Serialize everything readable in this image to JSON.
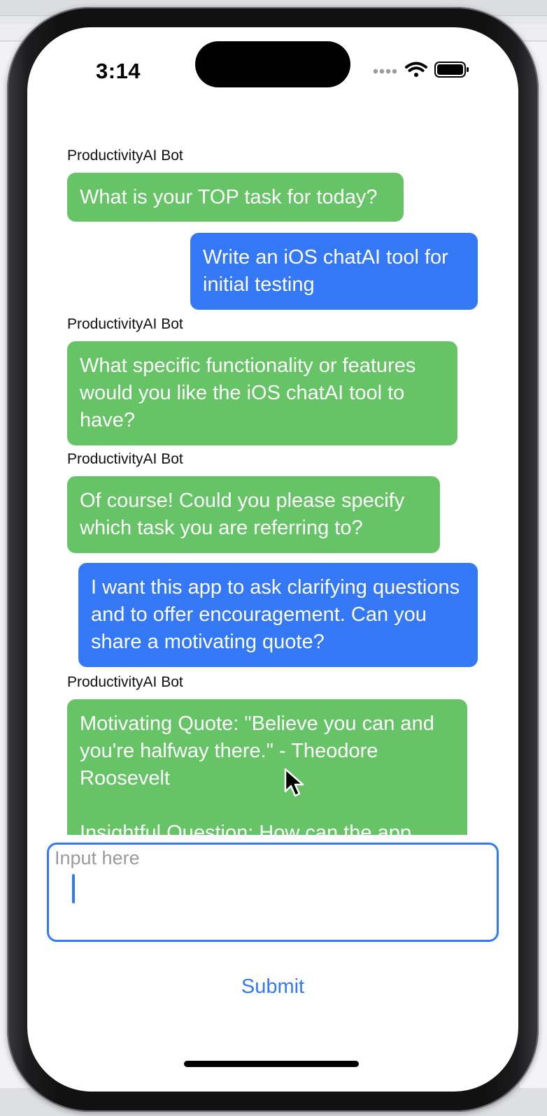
{
  "status_bar": {
    "time": "3:14"
  },
  "chat": {
    "bot_name": "ProductivityAI Bot",
    "messages": [
      {
        "sender": "bot",
        "text": "What is your TOP task for today?"
      },
      {
        "sender": "user",
        "text": "Write an iOS chatAI tool for initial testing"
      },
      {
        "sender": "bot",
        "text": "What specific functionality or features would you like the iOS chatAI tool to have?"
      },
      {
        "sender": "bot",
        "text": "Of course! Could you please specify which task you are referring to?"
      },
      {
        "sender": "user",
        "text": "I want this app to ask clarifying questions and to offer encouragement. Can you share a motivating quote?"
      },
      {
        "sender": "bot",
        "text": "Motivating Quote: \"Believe you can and you're halfway there.\" - Theodore Roosevelt\n\nInsightful Question: How can the app help users prioritize their tasks"
      }
    ]
  },
  "input": {
    "placeholder": "Input here",
    "value": ""
  },
  "submit_label": "Submit",
  "colors": {
    "bot_bubble": "#66c466",
    "user_bubble": "#3478f6",
    "accent": "#3478f6"
  },
  "icons": [
    "cellular-dots-icon",
    "wifi-icon",
    "battery-icon",
    "mouse-pointer-icon"
  ]
}
